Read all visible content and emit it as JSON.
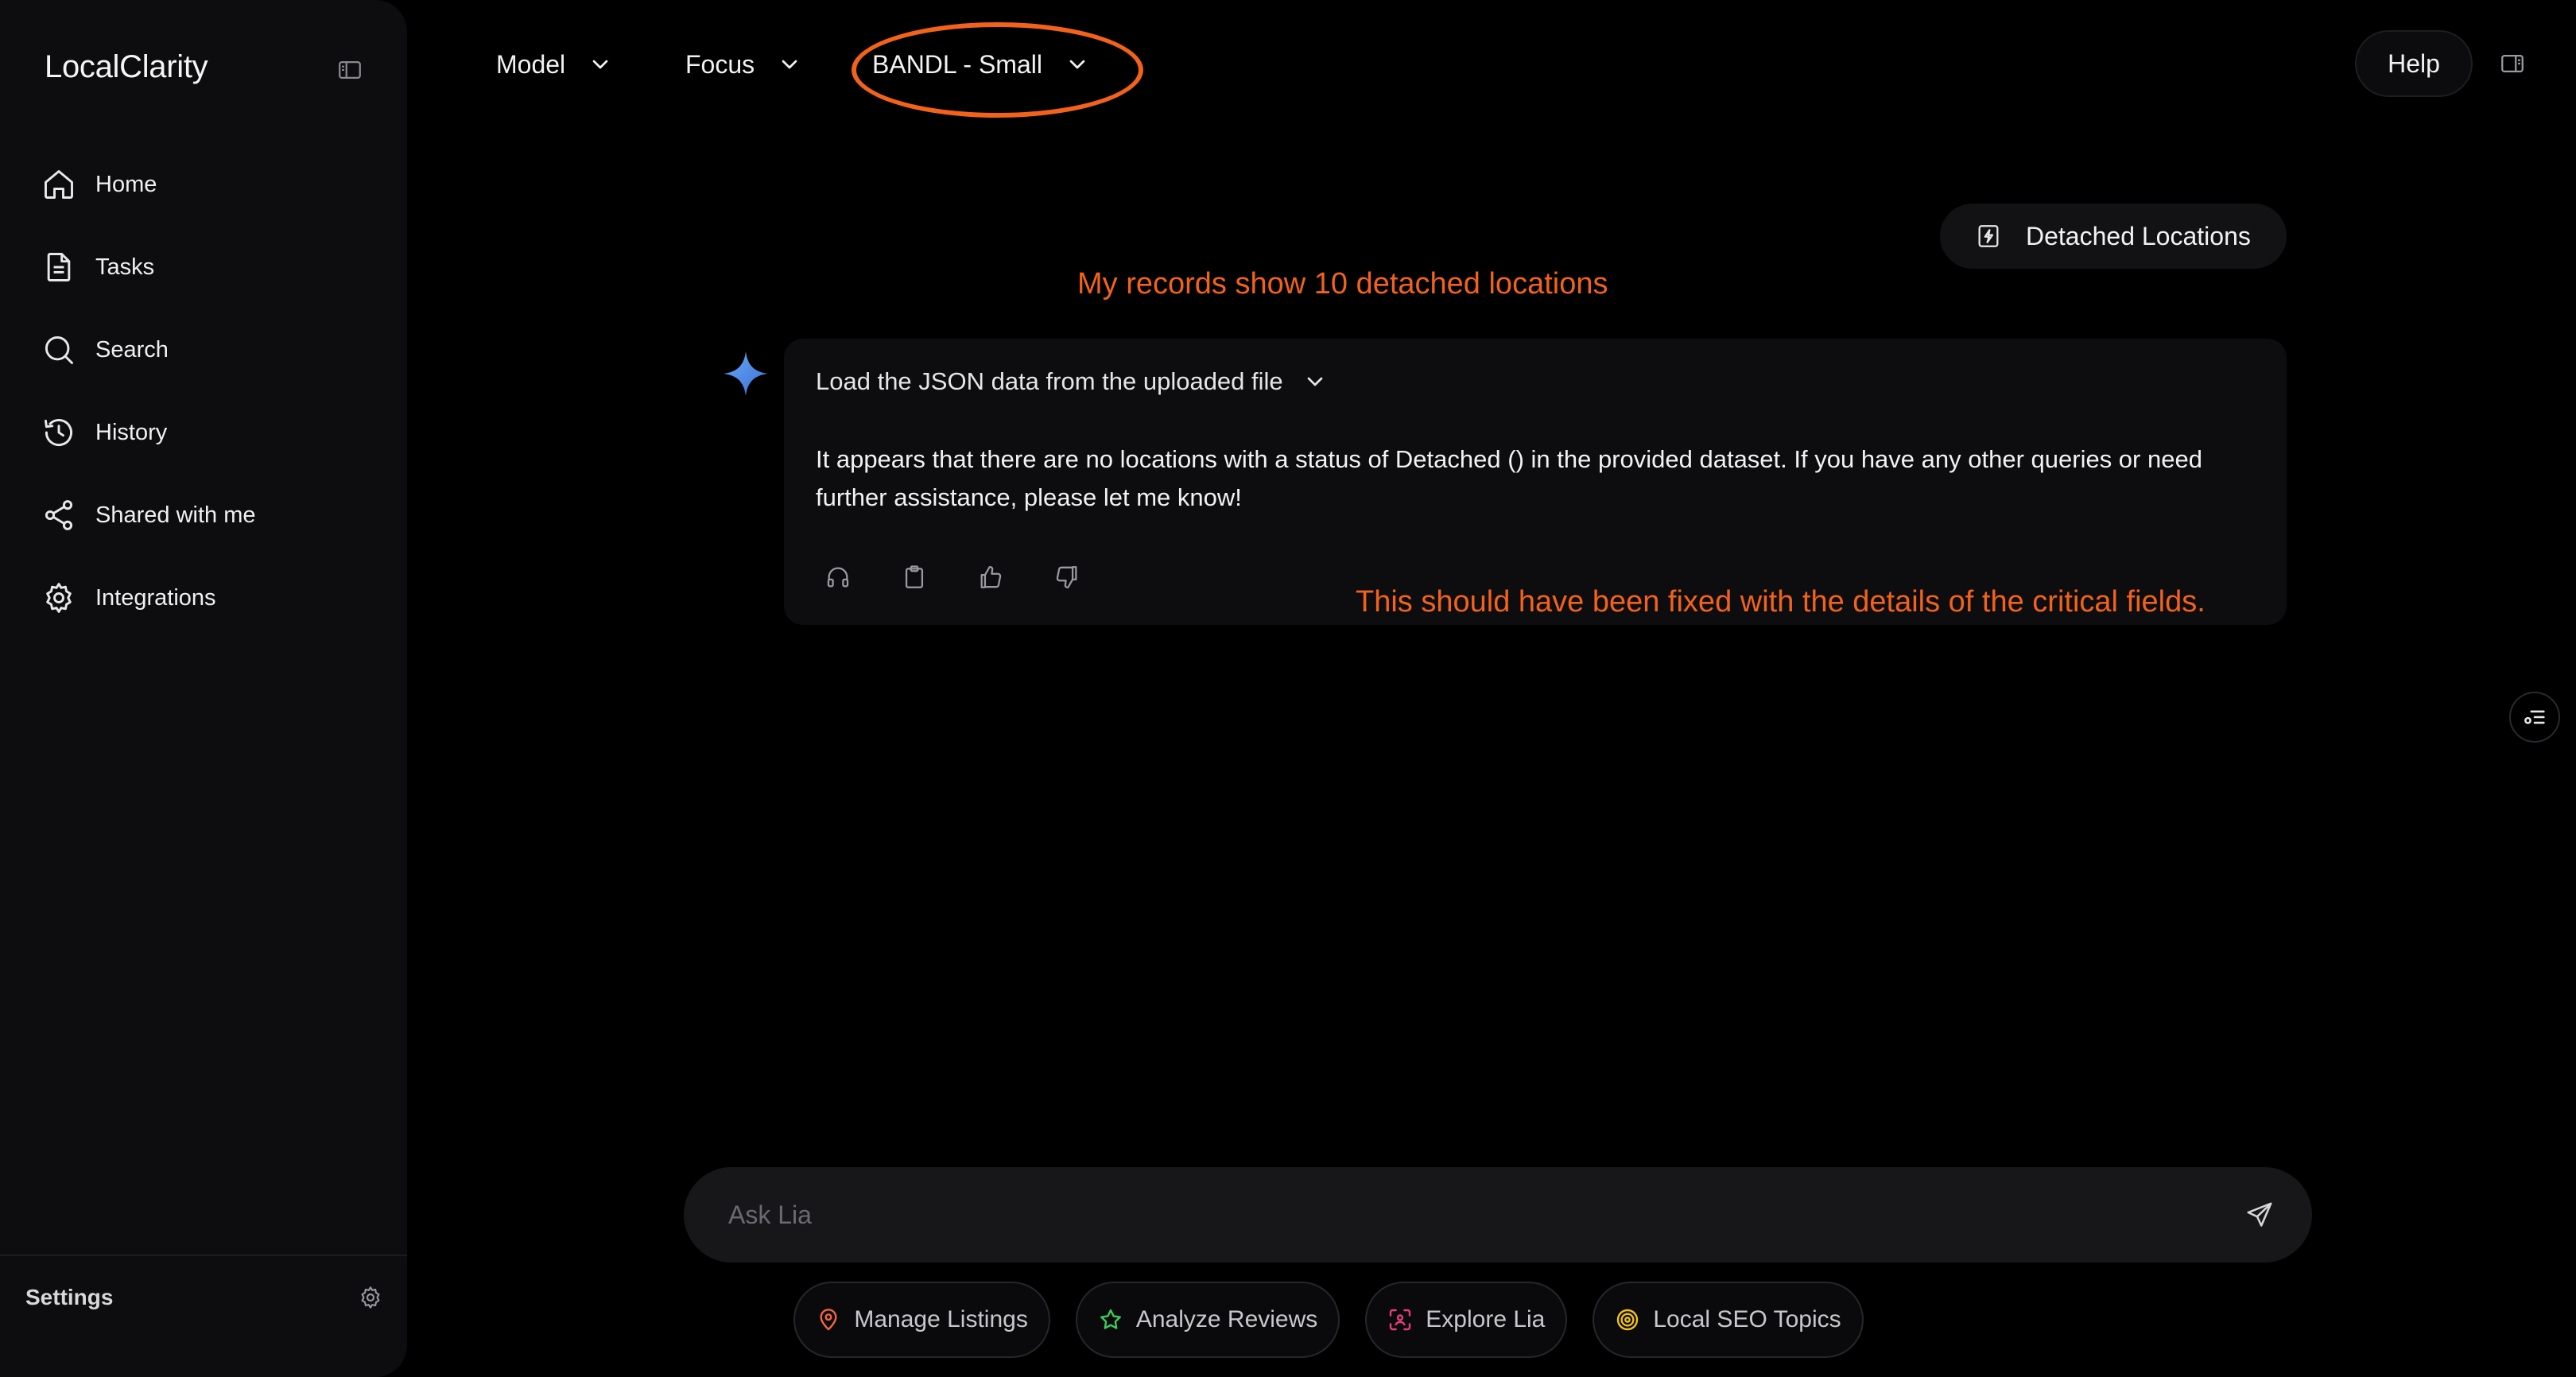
{
  "sidebar": {
    "brand": "LocalClarity",
    "items": [
      {
        "label": "Home",
        "icon": "home-icon"
      },
      {
        "label": "Tasks",
        "icon": "document-icon"
      },
      {
        "label": "Search",
        "icon": "search-icon"
      },
      {
        "label": "History",
        "icon": "history-icon"
      },
      {
        "label": "Shared with me",
        "icon": "share-icon"
      },
      {
        "label": "Integrations",
        "icon": "gear-icon"
      }
    ],
    "settings_label": "Settings"
  },
  "topbar": {
    "model_label": "Model",
    "focus_label": "Focus",
    "selected_model": "BANDL - Small",
    "help_label": "Help"
  },
  "chat": {
    "user_message": "Detached Locations",
    "ai_step": "Load the JSON data from the uploaded file",
    "ai_response": "It appears that there are no locations with a status of Detached () in the provided dataset. If you have any other queries or need further assistance, please let me know!",
    "actions": [
      "headphones-icon",
      "clipboard-icon",
      "thumbs-up-icon",
      "thumbs-down-icon"
    ]
  },
  "annotations": {
    "note_1": "My records show 10 detached locations",
    "note_2": "This should have been fixed with the details of the critical fields.",
    "color": "#f2621a"
  },
  "input": {
    "placeholder": "Ask Lia"
  },
  "chips": [
    {
      "label": "Manage Listings",
      "icon": "map-pin-icon",
      "color": "#f2683c"
    },
    {
      "label": "Analyze Reviews",
      "icon": "star-icon",
      "color": "#3ccb5c"
    },
    {
      "label": "Explore Lia",
      "icon": "scan-face-icon",
      "color": "#e83e78"
    },
    {
      "label": "Local SEO Topics",
      "icon": "target-icon",
      "color": "#f2c21a"
    }
  ],
  "colors": {
    "background": "#000000",
    "sidebar": "#0d0d0f",
    "card": "#0d0d10",
    "sparkle": "#4a8fe8"
  }
}
